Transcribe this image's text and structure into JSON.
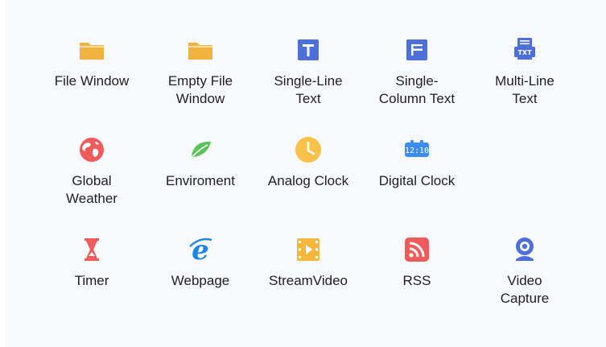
{
  "widgets": [
    {
      "label": "File Window",
      "icon": "folder-icon",
      "color": "#f0b43e"
    },
    {
      "label": "Empty File\nWindow",
      "icon": "empty-folder-icon",
      "color": "#f0b43e"
    },
    {
      "label": "Single-Line\nText",
      "icon": "single-line-text-icon",
      "color": "#4d6fd9"
    },
    {
      "label": "Single-\nColumn Text",
      "icon": "single-column-text-icon",
      "color": "#4d6fd9"
    },
    {
      "label": "Multi-Line\nText",
      "icon": "multi-line-text-icon",
      "color": "#4d6fd9",
      "glyph": "TXT"
    },
    {
      "label": "Global\nWeather",
      "icon": "globe-icon",
      "color": "#ef5a5a"
    },
    {
      "label": "Enviroment",
      "icon": "leaf-icon",
      "color": "#5cc35a"
    },
    {
      "label": "Analog Clock",
      "icon": "analog-clock-icon",
      "color": "#f8c24a"
    },
    {
      "label": "Digital Clock",
      "icon": "digital-clock-icon",
      "color": "#3d8df0",
      "glyph": "12:10"
    },
    {
      "label": "Timer",
      "icon": "hourglass-icon",
      "color": "#ef5a5a"
    },
    {
      "label": "Webpage",
      "icon": "browser-e-icon",
      "color": "#1f86e0"
    },
    {
      "label": "StreamVideo",
      "icon": "video-film-icon",
      "color": "#f6b83a"
    },
    {
      "label": "RSS",
      "icon": "rss-icon",
      "color": "#ef5a5a"
    },
    {
      "label": "Video\nCapture",
      "icon": "webcam-icon",
      "color": "#4d6fd9"
    }
  ]
}
